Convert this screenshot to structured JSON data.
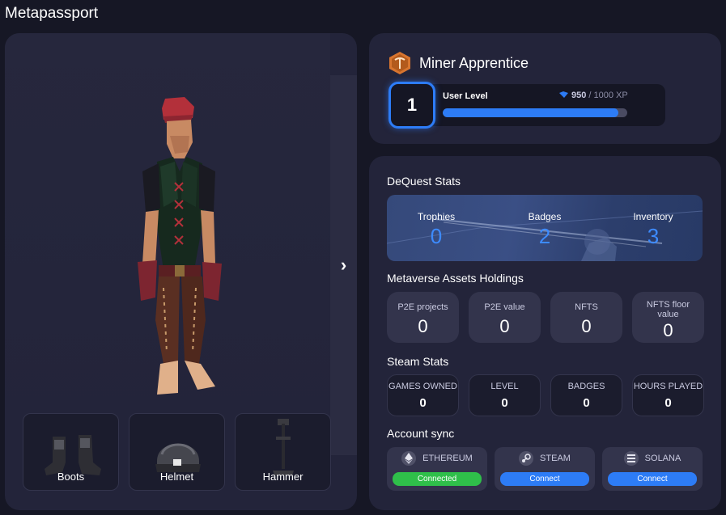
{
  "app": {
    "title": "Metapassport"
  },
  "character": {
    "items": [
      {
        "label": "Boots",
        "icon": "boots-icon"
      },
      {
        "label": "Helmet",
        "icon": "helmet-icon"
      },
      {
        "label": "Hammer",
        "icon": "hammer-icon"
      }
    ],
    "next_icon": "›"
  },
  "rank": {
    "title": "Miner Apprentice",
    "icon": "pickaxe-hex-icon"
  },
  "level": {
    "value": "1",
    "label": "User Level",
    "xp_current": "950",
    "xp_total": " / 1000 XP",
    "progress": 0.95
  },
  "dequest": {
    "title": "DeQuest Stats",
    "stats": [
      {
        "label": "Trophies",
        "value": "0"
      },
      {
        "label": "Badges",
        "value": "2"
      },
      {
        "label": "Inventory",
        "value": "3"
      }
    ]
  },
  "assets": {
    "title": "Metaverse Assets Holdings",
    "cards": [
      {
        "label": "P2E projects",
        "value": "0"
      },
      {
        "label": "P2E value",
        "value": "0"
      },
      {
        "label": "NFTS",
        "value": "0"
      },
      {
        "label": "NFTS floor value",
        "value": "0"
      }
    ]
  },
  "steam": {
    "title": "Steam Stats",
    "cards": [
      {
        "label": "GAMES OWNED",
        "value": "0"
      },
      {
        "label": "LEVEL",
        "value": "0"
      },
      {
        "label": "BADGES",
        "value": "0"
      },
      {
        "label": "HOURS PLAYED",
        "value": "0"
      }
    ]
  },
  "sync": {
    "title": "Account sync",
    "accounts": [
      {
        "name": "ETHEREUM",
        "button": "Connected",
        "color": "#2fbf4a",
        "icon": "ethereum-icon"
      },
      {
        "name": "STEAM",
        "button": "Connect",
        "color": "#2d7cf6",
        "icon": "steam-icon"
      },
      {
        "name": "SOLANA",
        "button": "Connect",
        "color": "#2d7cf6",
        "icon": "solana-icon"
      }
    ]
  },
  "colors": {
    "accent": "#2d7cf6",
    "connected": "#2fbf4a",
    "panel": "#23243a",
    "background": "#161725"
  }
}
